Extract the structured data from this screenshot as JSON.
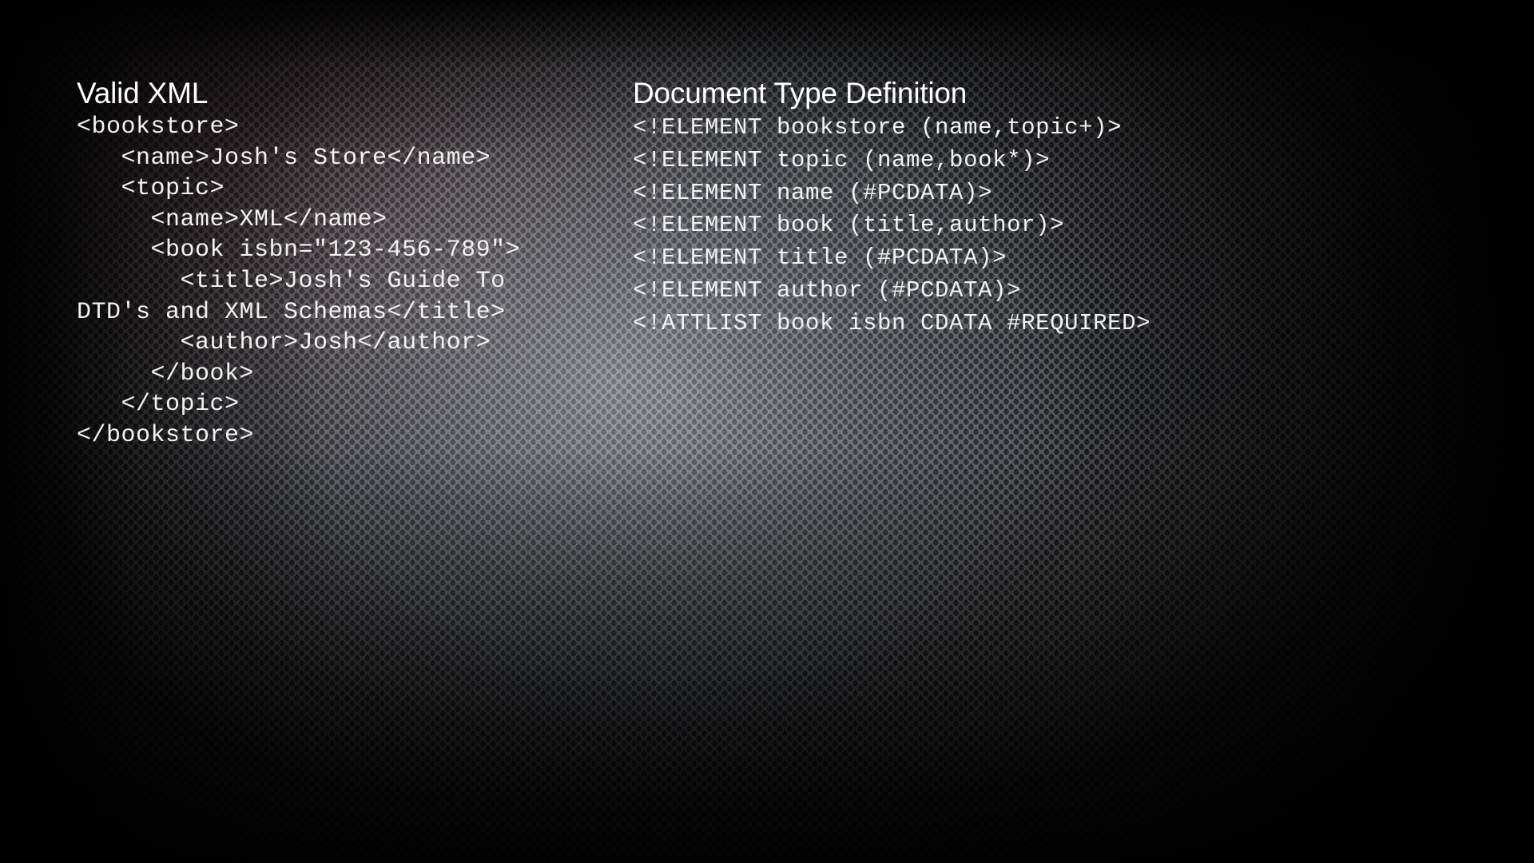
{
  "slide": {
    "background_style": "perforated-dark-metal",
    "colors": {
      "text": "#f2f2f2",
      "heading": "#ffffff",
      "metal_light": "#7a7f88",
      "metal_dark": "#0d0f12",
      "vignette": "#000000",
      "corner_tint": "#5c1e22"
    }
  },
  "left_column": {
    "heading": "Valid XML",
    "code_lines": [
      "<bookstore>",
      "   <name>Josh's Store</name>",
      "   <topic>",
      "     <name>XML</name>",
      "     <book isbn=\"123-456-789\">",
      "       <title>Josh's Guide To",
      "DTD's and XML Schemas</title>",
      "       <author>Josh</author>",
      "     </book>",
      "   </topic>",
      "</bookstore>"
    ]
  },
  "right_column": {
    "heading": "Document Type Definition",
    "code_lines": [
      "<!ELEMENT bookstore (name,topic+)>",
      "<!ELEMENT topic (name,book*)>",
      "<!ELEMENT name (#PCDATA)>",
      "<!ELEMENT book (title,author)>",
      "<!ELEMENT title (#PCDATA)>",
      "<!ELEMENT author (#PCDATA)>",
      "<!ATTLIST book isbn CDATA #REQUIRED>"
    ]
  }
}
